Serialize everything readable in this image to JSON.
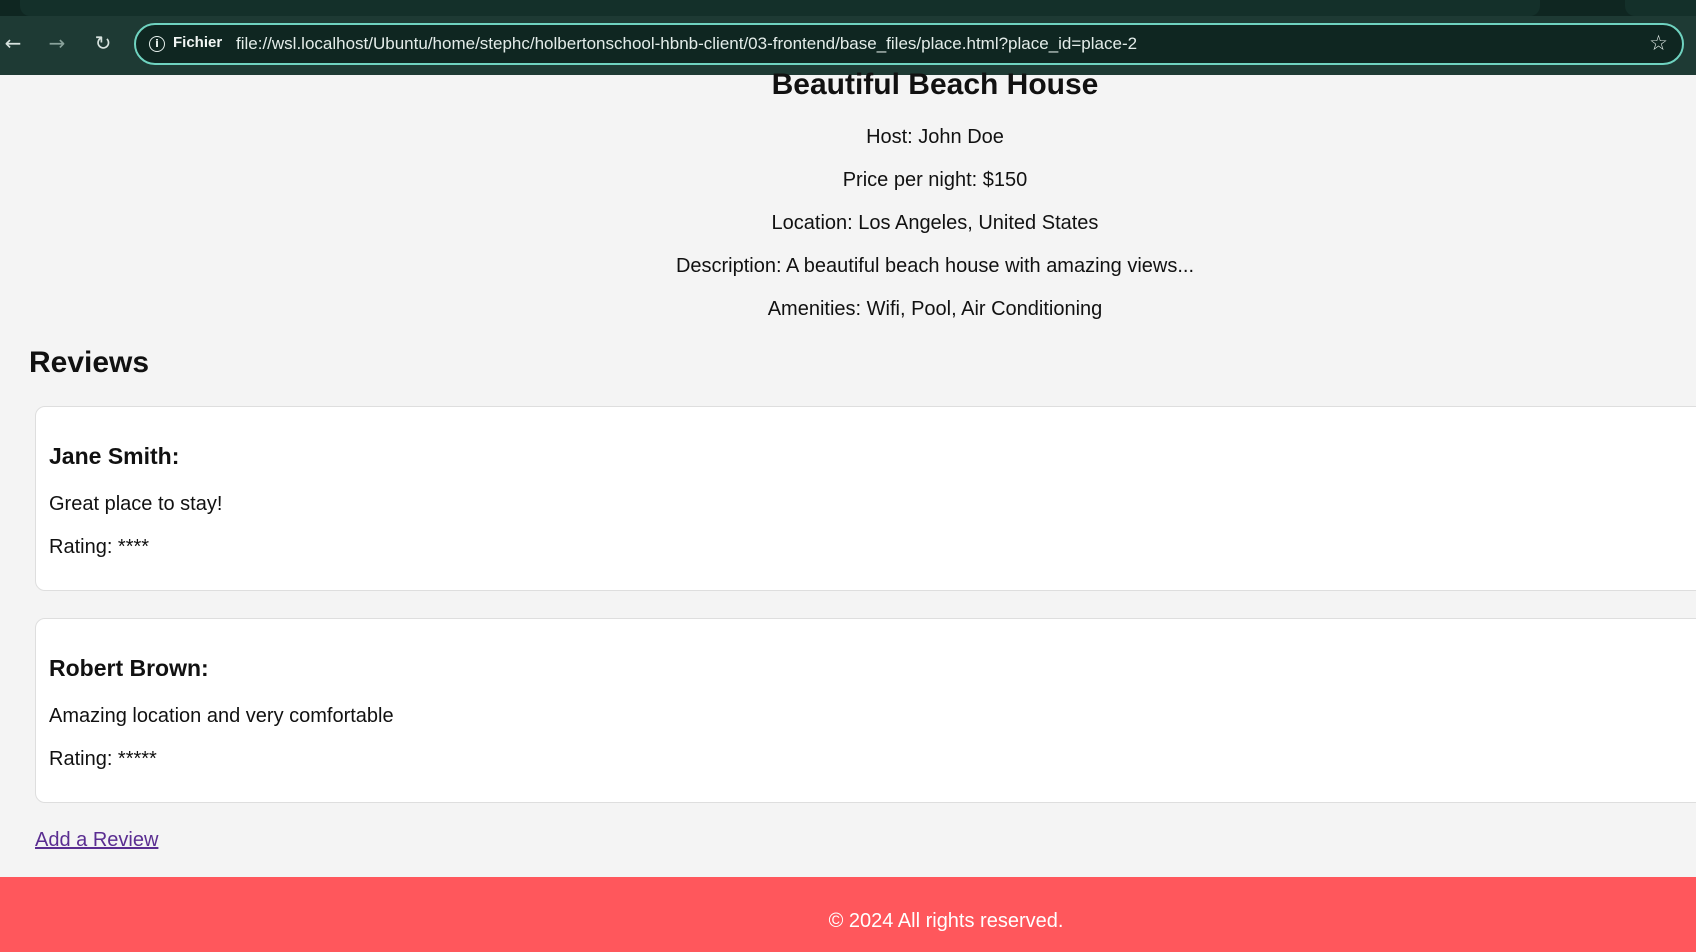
{
  "browser": {
    "security_label": "Fichier",
    "url": "file://wsl.localhost/Ubuntu/home/stephc/holbertonschool-hbnb-client/03-frontend/base_files/place.html?place_id=place-2",
    "back_icon": "arrow-left",
    "forward_icon": "arrow-right",
    "reload_icon": "reload",
    "bookmark_icon": "star-outline"
  },
  "place": {
    "title": "Beautiful Beach House",
    "host": "Host: John Doe",
    "price": "Price per night: $150",
    "location": "Location: Los Angeles, United States",
    "description": "Description: A beautiful beach house with amazing views...",
    "amenities": "Amenities: Wifi, Pool, Air Conditioning"
  },
  "reviews": {
    "heading": "Reviews",
    "items": [
      {
        "author": "Jane Smith:",
        "comment": "Great place to stay!",
        "rating": "Rating: ****"
      },
      {
        "author": "Robert Brown:",
        "comment": "Amazing location and very comfortable",
        "rating": "Rating: *****"
      }
    ]
  },
  "add_review_link": "Add a Review",
  "footer": {
    "text": "© 2024 All rights reserved."
  },
  "colors": {
    "footer_bg": "#ff575c",
    "page_bg": "#f4f4f4",
    "browser_chrome": "#1e3a34",
    "omnibox_border": "#6fd3c0",
    "link": "#5a2d91"
  }
}
